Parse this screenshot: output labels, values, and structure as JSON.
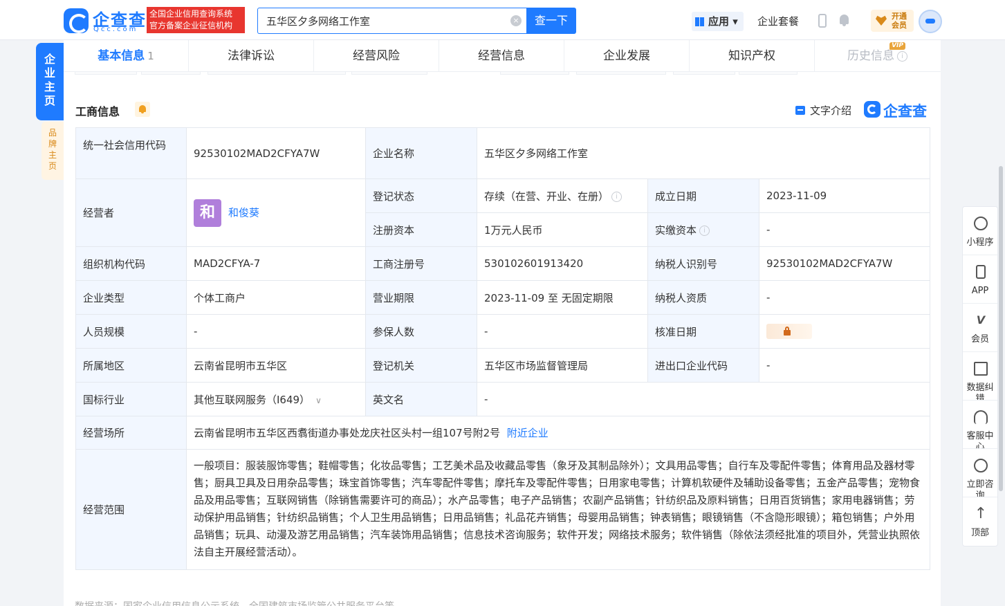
{
  "header": {
    "logo_text": "企查查",
    "logo_sub": "Qcc.com",
    "badge_line1": "全国企业信用查询系统",
    "badge_line2": "官方备案企业征信机构",
    "search_value": "五华区夕多网络工作室",
    "search_button": "查一下",
    "apps_label": "应用 ▾",
    "combo_label": "企业套餐",
    "vip_open_line1": "开通",
    "vip_open_line2": "会员",
    "icons": [
      "search-clear-icon",
      "grid-icon",
      "phone-icon",
      "bell-icon",
      "heart-icon",
      "avatar"
    ]
  },
  "left_tabs": {
    "main": "企业主页",
    "brand": "品牌主页"
  },
  "tabs": [
    {
      "label": "基本信息",
      "count": "1",
      "active": true
    },
    {
      "label": "法律诉讼"
    },
    {
      "label": "经营风险"
    },
    {
      "label": "经营信息"
    },
    {
      "label": "企业发展"
    },
    {
      "label": "知识产权"
    },
    {
      "label": "历史信息",
      "vip": "VIP",
      "info": "i"
    }
  ],
  "section": {
    "title": "工商信息",
    "text_intro": "文字介绍",
    "brand": "企查查"
  },
  "table": {
    "credit_code_label": "统一社会信用代码",
    "credit_code": "92530102MAD2CFYA7W",
    "company_name_label": "企业名称",
    "company_name": "五华区夕多网络工作室",
    "operator_label": "经营者",
    "operator_avatar": "和",
    "operator_name": "和俊葵",
    "status_label": "登记状态",
    "status": "存续（在营、开业、在册）",
    "founded_label": "成立日期",
    "founded": "2023-11-09",
    "capital_label": "注册资本",
    "capital": "1万元人民币",
    "paid_label": "实缴资本",
    "paid": "-",
    "org_code_label": "组织机构代码",
    "org_code": "MAD2CFYA-7",
    "reg_no_label": "工商注册号",
    "reg_no": "530102601913420",
    "taxpayer_id_label": "纳税人识别号",
    "taxpayer_id": "92530102MAD2CFYA7W",
    "type_label": "企业类型",
    "type": "个体工商户",
    "term_label": "营业期限",
    "term": "2023-11-09 至 无固定期限",
    "tax_qual_label": "纳税人资质",
    "tax_qual": "-",
    "staff_label": "人员规模",
    "staff": "-",
    "insured_label": "参保人数",
    "insured": "-",
    "approval_label": "核准日期",
    "region_label": "所属地区",
    "region": "云南省昆明市五华区",
    "authority_label": "登记机关",
    "authority": "五华区市场监督管理局",
    "import_export_label": "进出口企业代码",
    "import_export": "-",
    "industry_label": "国标行业",
    "industry": "其他互联网服务（I649）",
    "english_label": "英文名",
    "english": "-",
    "address_label": "经营场所",
    "address": "云南省昆明市五华区西翥街道办事处龙庆社区头村一组107号附2号",
    "nearby_link": "附近企业",
    "scope_label": "经营范围",
    "scope": "一般项目：服装服饰零售；鞋帽零售；化妆品零售；工艺美术品及收藏品零售（象牙及其制品除外）；文具用品零售；自行车及零配件零售；体育用品及器材零售；厨具卫具及日用杂品零售；珠宝首饰零售；汽车零配件零售；摩托车及零配件零售；日用家电零售；计算机软硬件及辅助设备零售；五金产品零售；宠物食品及用品零售；互联网销售（除销售需要许可的商品）；水产品零售；电子产品销售；农副产品销售；针纺织品及原料销售；日用百货销售；家用电器销售；劳动保护用品销售；针纺织品销售；个人卫生用品销售；日用品销售；礼品花卉销售；母婴用品销售；钟表销售；眼镜销售（不含隐形眼镜）；箱包销售；户外用品销售；玩具、动漫及游艺用品销售；汽车装饰用品销售；信息技术咨询服务；软件开发；网络技术服务；软件销售（除依法须经批准的项目外，凭营业执照依法自主开展经营活动）。"
  },
  "footer_note": "数据来源：国家企业信用信息公示系统、全国建筑市场监管公共服务平台等",
  "right_bar": [
    {
      "label": "小程序",
      "icon": "mini-program-icon"
    },
    {
      "label": "APP",
      "icon": "phone-app-icon"
    },
    {
      "label": "会员",
      "icon": "vip-icon"
    },
    {
      "label": "数据纠错",
      "icon": "edit-icon"
    },
    {
      "label": "客服中心",
      "icon": "headset-icon"
    },
    {
      "label": "立即咨询",
      "icon": "chat-icon"
    },
    {
      "label": "顶部",
      "icon": "arrow-up-icon"
    }
  ],
  "colors": {
    "accent": "#1f7bff",
    "label_bg": "#f2f7ff",
    "badge_red": "#e8362f",
    "vip_orange": "#e9a43a"
  }
}
